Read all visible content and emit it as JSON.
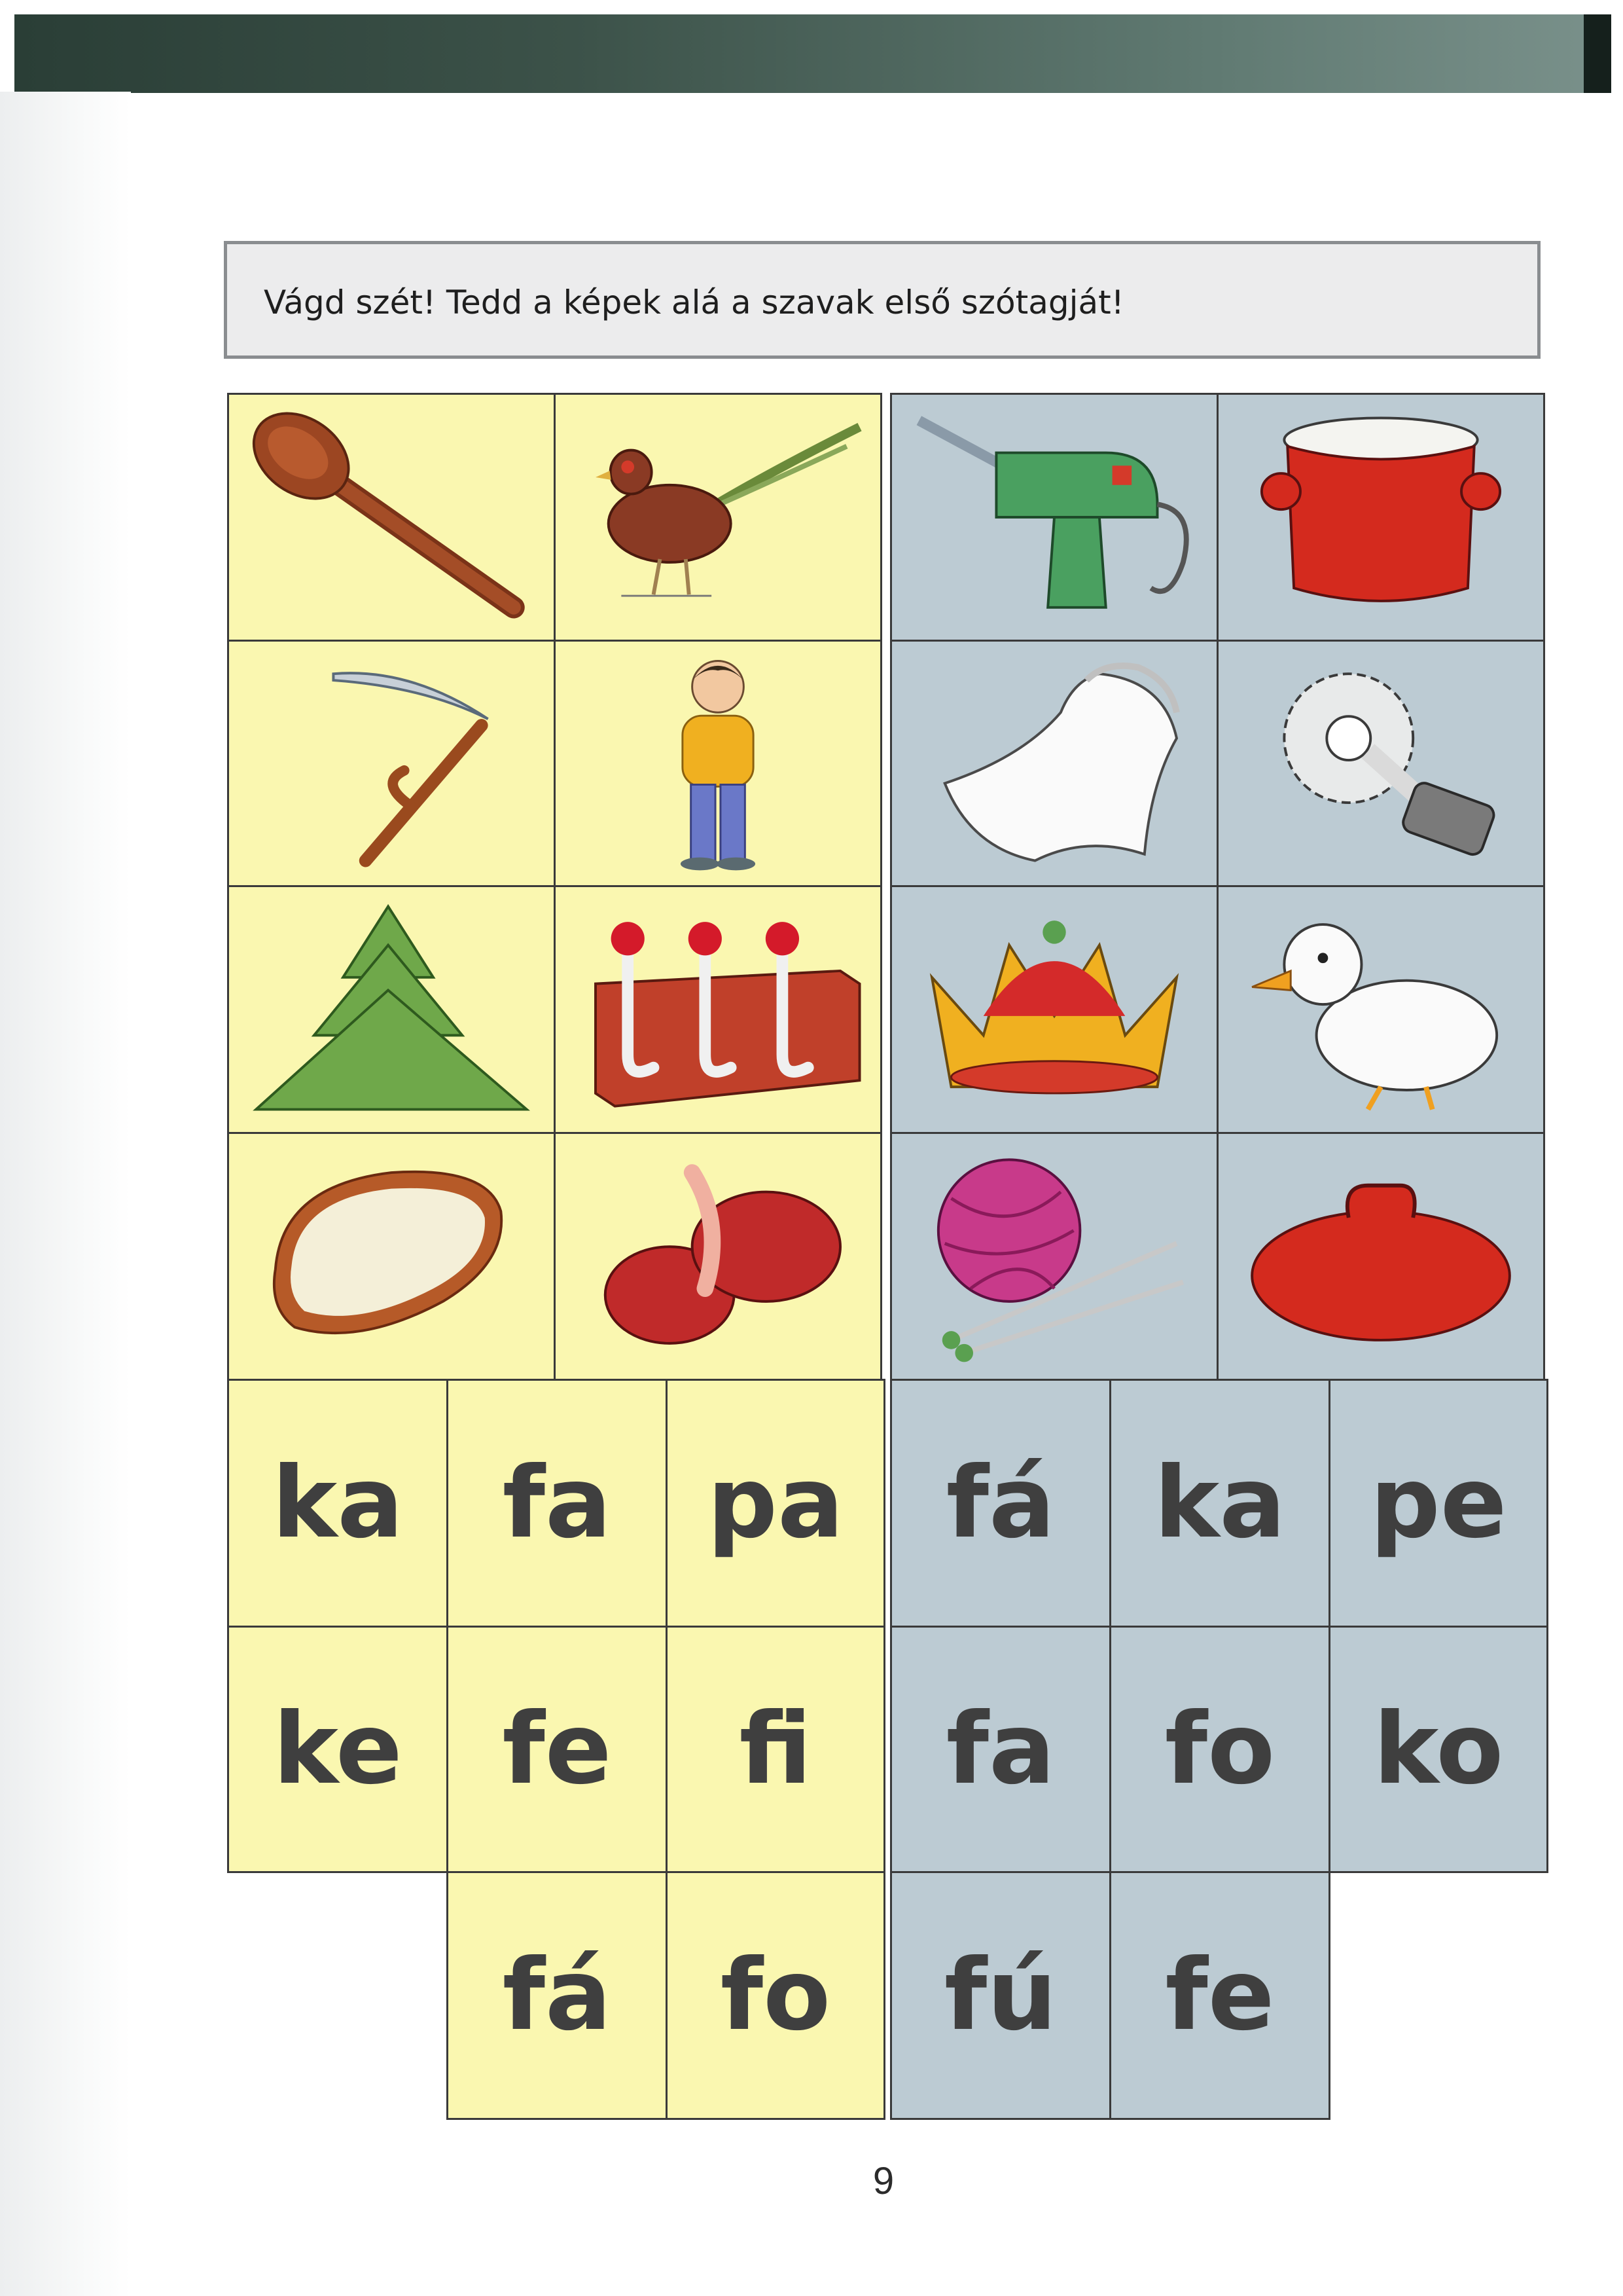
{
  "instruction": "Vágd szét! Tedd a képek alá a szavak első szótagját!",
  "pictures": {
    "left": [
      "wooden-spoon",
      "pheasant",
      "scythe",
      "boy",
      "fir-tree",
      "coat-hooks",
      "bread-slice",
      "slippers"
    ],
    "right": [
      "electric-drill",
      "pot",
      "veil",
      "pastry-wheel",
      "crown",
      "duck",
      "yarn-ball",
      "pot-lid"
    ]
  },
  "syllables": {
    "yellow_row1": [
      "ka",
      "fa",
      "pa"
    ],
    "yellow_row2": [
      "ke",
      "fe",
      "fi"
    ],
    "yellow_row3": [
      "fá",
      "fo"
    ],
    "blue_row1": [
      "fá",
      "ka",
      "pe"
    ],
    "blue_row2": [
      "fa",
      "fo",
      "ko"
    ],
    "blue_row3": [
      "fú",
      "fe"
    ]
  },
  "page_number": "9",
  "colors": {
    "yellow": "#faf7b0",
    "blue": "#bccbd3",
    "border": "#3a3a3a",
    "syllable_text": "#3f3f3f"
  }
}
